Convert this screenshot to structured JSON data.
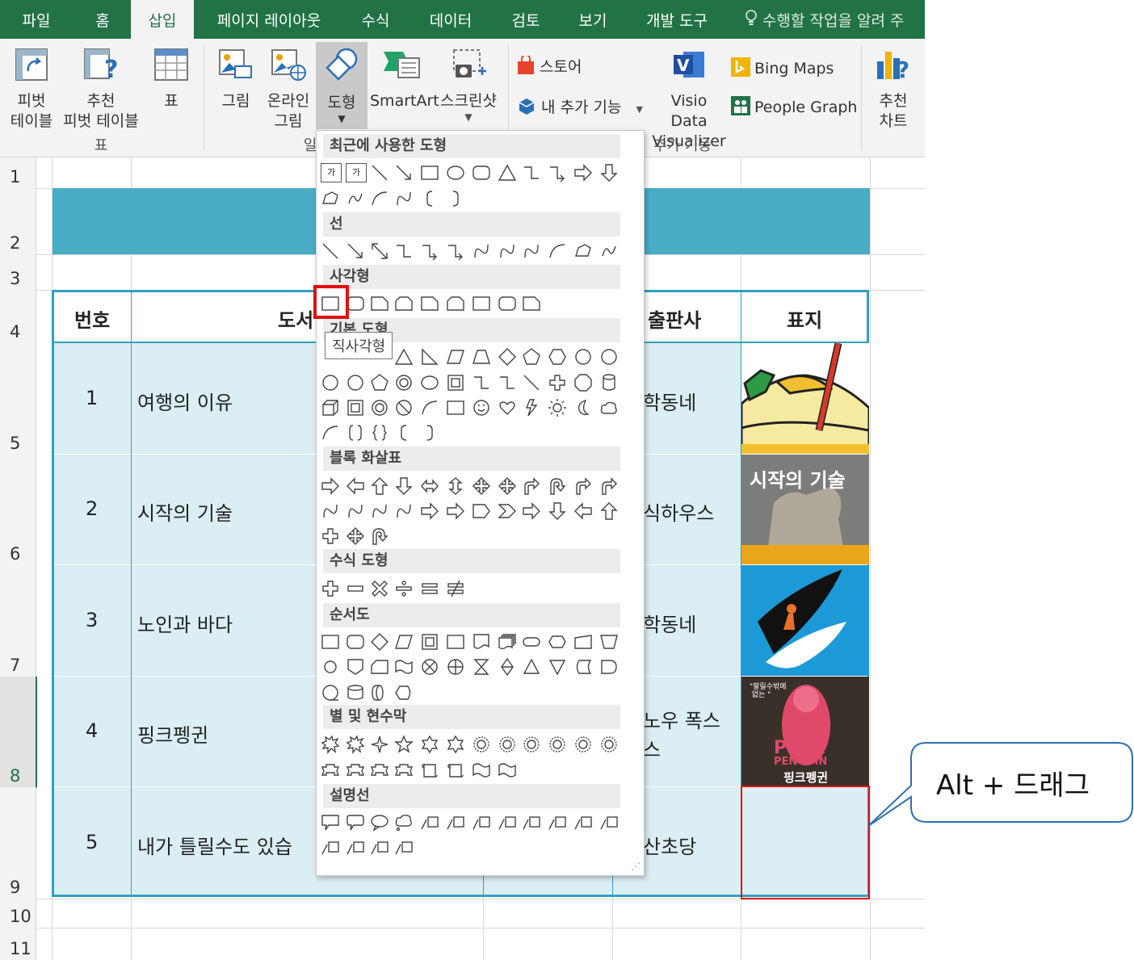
{
  "tabs": [
    "파일",
    "홈",
    "삽입",
    "페이지 레이아웃",
    "수식",
    "데이터",
    "검토",
    "보기",
    "개발 도구"
  ],
  "active_tab": "삽입",
  "tell_me": "수행할 작업을 알려 주",
  "ribbon": {
    "pivot": [
      "피벗",
      "테이블"
    ],
    "recommended_pivot": [
      "추천",
      "피벗 테이블"
    ],
    "table": "표",
    "picture": "그림",
    "online_picture": [
      "온라인",
      "그림"
    ],
    "shapes": "도형",
    "smartart": "SmartArt",
    "screenshot": "스크린샷",
    "group_tables": "표",
    "group_illustrations_fragment": "일",
    "store": "스토어",
    "my_addins": "내 추가 기능",
    "visio": [
      "Visio Data",
      "Visualizer"
    ],
    "bing_maps": "Bing Maps",
    "people_graph": "People Graph",
    "group_addins": "추가 기능",
    "recommended_charts": [
      "추천",
      "차트"
    ]
  },
  "rows": [
    "1",
    "2",
    "3",
    "4",
    "5",
    "6",
    "7",
    "8",
    "9",
    "10",
    "11"
  ],
  "table": {
    "headers": {
      "no": "번호",
      "title_fragment": "도서",
      "publisher": "출판사",
      "cover": "표지"
    },
    "items": [
      {
        "no": "1",
        "title": "여행의 이유",
        "publisher": "학동네"
      },
      {
        "no": "2",
        "title": "시작의 기술",
        "publisher": "식하우스"
      },
      {
        "no": "3",
        "title": "노인과 바다",
        "publisher": "학동네"
      },
      {
        "no": "4",
        "title": "핑크펭귄",
        "publisher": "노우 폭스",
        "publisher2": "스"
      },
      {
        "no": "5",
        "title": "내가 틀릴수도 있습",
        "publisher": "산초당"
      }
    ],
    "cover_texts": {
      "book2_title": "시작의 기술",
      "book4_top": "\"팔릴수밖에 \n 없는 \"",
      "book4_pink": "PINK",
      "book4_penguin": "PENGUIN",
      "book4_kr": "핑크펭귄"
    }
  },
  "dropdown": {
    "sections": [
      "최근에 사용한 도형",
      "선",
      "사각형",
      "기본 도형",
      "블록 화살표",
      "수식 도형",
      "순서도",
      "별 및 현수막",
      "설명선"
    ],
    "tooltip": "직사각형",
    "text_icons": [
      "가",
      "가"
    ],
    "braces": [
      "{",
      "}"
    ]
  },
  "callout_text": "Alt + 드래그",
  "colors": {
    "excel_green": "#217346",
    "title_band": "#4bacc6",
    "table_fill": "#daeef3",
    "table_border": "#31a0c0",
    "highlight_red": "#e01010"
  }
}
